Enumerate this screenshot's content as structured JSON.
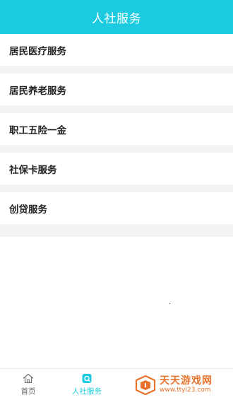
{
  "header": {
    "title": "人社服务"
  },
  "menu": {
    "items": [
      {
        "label": "居民医疗服务"
      },
      {
        "label": "居民养老服务"
      },
      {
        "label": "职工五险一金"
      },
      {
        "label": "社保卡服务"
      },
      {
        "label": "创贷服务"
      }
    ]
  },
  "tabbar": {
    "tabs": [
      {
        "label": "首页",
        "icon": "home-icon",
        "active": false
      },
      {
        "label": "人社服务",
        "icon": "social-service-icon",
        "active": true
      }
    ]
  },
  "watermark": {
    "title": "天天游戏网",
    "url": "www.ttyl23.com"
  },
  "colors": {
    "accent": "#1ccbe0",
    "divider": "#f3f3f3",
    "watermark": "#e8732c"
  }
}
